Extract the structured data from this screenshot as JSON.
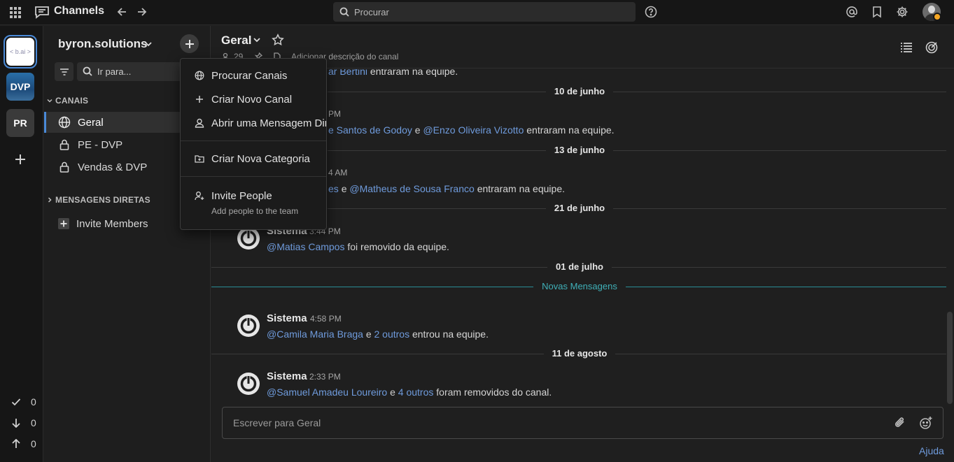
{
  "topbar": {
    "product": "Channels",
    "search_placeholder": "Procurar"
  },
  "rail": {
    "teams": [
      {
        "label": "< b.ai >",
        "name": "byron.solutions",
        "active": true
      },
      {
        "label": "DVP"
      },
      {
        "label": "PR"
      }
    ],
    "stats": [
      {
        "icon": "check-icon",
        "value": "0"
      },
      {
        "icon": "arrow-down-icon",
        "value": "0"
      },
      {
        "icon": "arrow-up-icon",
        "value": "0"
      }
    ]
  },
  "sidebar": {
    "team_name": "byron.solutions",
    "find_placeholder": "Ir para...",
    "categories": {
      "channels": "CANAIS",
      "direct": "MENSAGENS DIRETAS"
    },
    "channels": [
      {
        "label": "Geral",
        "icon": "globe-icon",
        "active": true
      },
      {
        "label": "PE - DVP",
        "icon": "lock-icon"
      },
      {
        "label": "Vendas & DVP",
        "icon": "lock-icon"
      }
    ],
    "invite_label": "Invite Members"
  },
  "dropdown": {
    "items": [
      {
        "label": "Procurar Canais",
        "icon": "globe-icon"
      },
      {
        "label": "Criar Novo Canal",
        "icon": "plus-icon"
      },
      {
        "label": "Abrir uma Mensagem Dir",
        "icon": "person-icon"
      },
      {
        "label": "Criar Nova Categoria",
        "icon": "folder-plus-icon"
      },
      {
        "label": "Invite People",
        "icon": "person-add-icon"
      }
    ],
    "invite_sub": "Add people to the team"
  },
  "header": {
    "channel_name": "Geral",
    "member_count": "29",
    "description_placeholder": "Adicionar descrição do canal"
  },
  "messages": {
    "frag_top": {
      "link": "ar Bertini",
      "text": "entraram na equipe."
    },
    "date1": "10 de junho",
    "frag_pm1": "PM",
    "frag_line1": {
      "link1": "e Santos de Godoy",
      "mid": "e",
      "link2": "@Enzo Oliveira Vizotto",
      "text": "entraram na equipe."
    },
    "date2": "13 de junho",
    "frag_am": "4 AM",
    "frag_line2": {
      "link1": "es",
      "mid": "e",
      "link2": "@Matheus de Sousa Franco",
      "text": "entraram na equipe."
    },
    "date3": "21 de junho",
    "post1": {
      "author": "Sistema",
      "time": "3:44 PM",
      "mention": "@Matias Campos",
      "t1": "foi",
      "t2": "removido da equipe",
      "end": "."
    },
    "date4": "01 de julho",
    "new_messages": "Novas Mensagens",
    "post2": {
      "author": "Sistema",
      "time": "4:58 PM",
      "mention": "@Camila Maria Braga",
      "and": "e",
      "others": "2 outros",
      "t1": "entrou na equipe",
      "end": "."
    },
    "date5": "11 de agosto",
    "post3": {
      "author": "Sistema",
      "time": "2:33 PM",
      "mention": "@Samuel Amadeu Loureiro",
      "and": "e",
      "others": "4 outros",
      "t1": "foram",
      "t2": "removidos do canal",
      "end": "."
    }
  },
  "composer": {
    "placeholder": "Escrever para Geral"
  },
  "help_label": "Ajuda",
  "colors": {
    "accent": "#4a8ad8",
    "link": "#6f9bdc",
    "new_messages": "#3fb0b8",
    "away_status": "#f5a623"
  }
}
